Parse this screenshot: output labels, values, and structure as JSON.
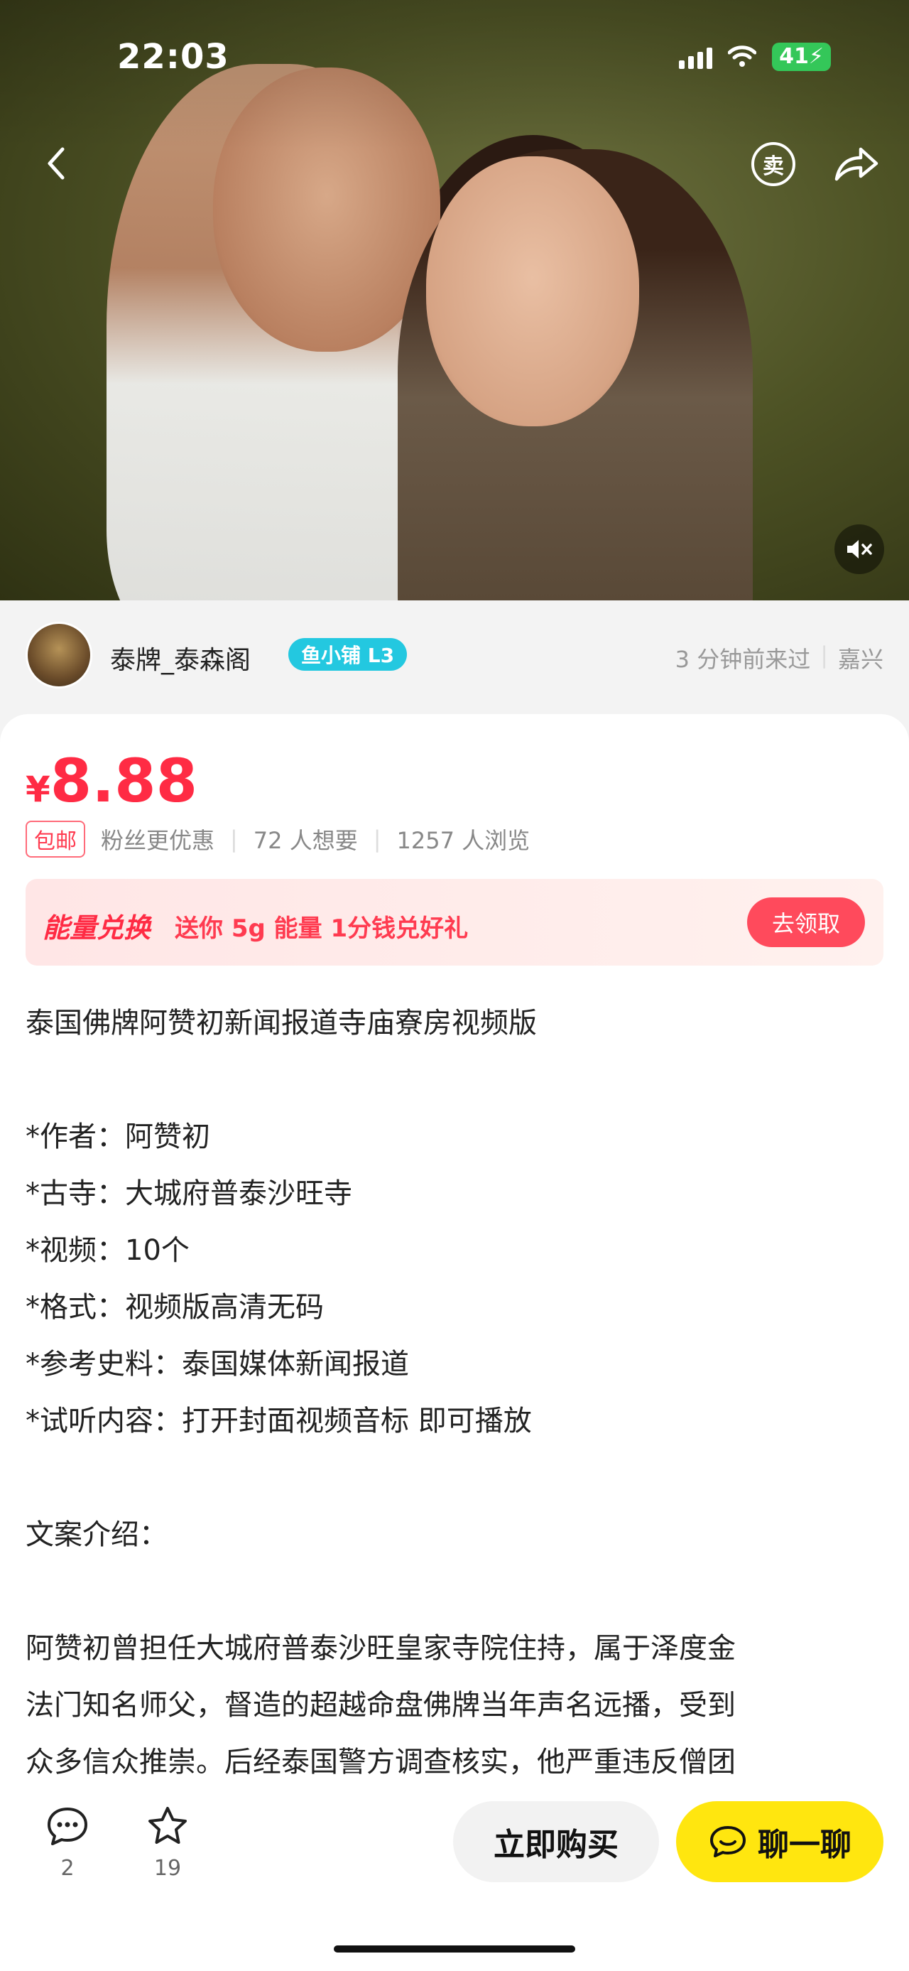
{
  "status_bar": {
    "time": "22:03",
    "battery": "41"
  },
  "hero": {
    "sell_icon_label": "卖"
  },
  "seller": {
    "name": "泰牌_泰森阁",
    "badge": "鱼小铺 L3",
    "last_seen": "3 分钟前来过",
    "location": "嘉兴"
  },
  "listing": {
    "currency": "¥",
    "price": "8.88",
    "shipping_tag": "包邮",
    "fan_discount": "粉丝更优惠",
    "wants": "72 人想要",
    "views": "1257 人浏览"
  },
  "energy_banner": {
    "title": "能量兑换",
    "description": "送你 5g 能量 1分钱兑好礼",
    "button": "去领取"
  },
  "description_lines": [
    "泰国佛牌阿赞初新闻报道寺庙寮房视频版",
    "",
    "*作者：阿赞初",
    "*古寺：大城府普泰沙旺寺",
    "*视频：10个",
    "*格式：视频版高清无码",
    "*参考史料：泰国媒体新闻报道",
    "*试听内容：打开封面视频音标 即可播放",
    "",
    "文案介绍：",
    "",
    "阿赞初曾担任大城府普泰沙旺皇家寺院住持，属于泽度金",
    "法门知名师父，督造的超越命盘佛牌当年声名远播，受到",
    "众多信众推崇。后经泰国警方调查核实，他严重违反僧团"
  ],
  "bottom_bar": {
    "comment_count": "2",
    "favorite_count": "19",
    "buy_label": "立即购买",
    "chat_label": "聊一聊"
  },
  "colors": {
    "price_red": "#ff2b44",
    "badge_cyan": "#23c8e0",
    "chat_yellow": "#ffe60f"
  }
}
